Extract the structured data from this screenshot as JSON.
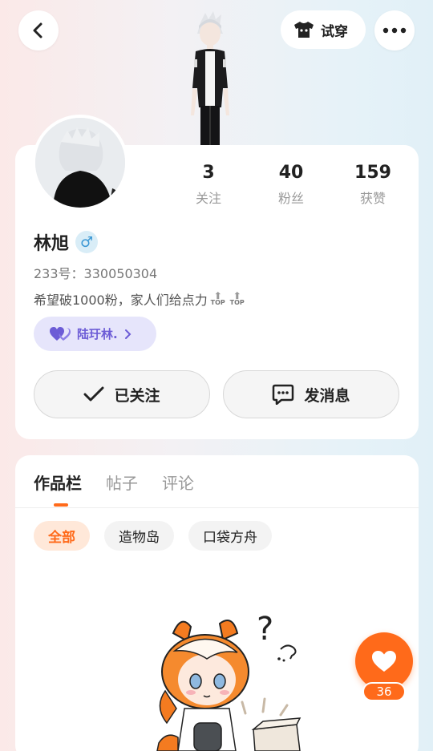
{
  "header": {
    "try_on_label": "试穿",
    "icons": {
      "back": "chevron-left-icon",
      "try_on": "tshirt-icon",
      "more": "more-dots-icon"
    }
  },
  "profile": {
    "stats": [
      {
        "value": "3",
        "label": "关注"
      },
      {
        "value": "40",
        "label": "粉丝"
      },
      {
        "value": "159",
        "label": "获赞"
      }
    ],
    "name": "林旭",
    "gender_symbol": "♂",
    "uid": "233号：330050304",
    "bio": "希望破1000粉，家人们给点力",
    "bio_badges": [
      "TOP",
      "TOP"
    ],
    "partner_label": "陆玗林.",
    "follow_label": "已关注",
    "message_label": "发消息"
  },
  "works": {
    "tabs": [
      "作品栏",
      "帖子",
      "评论"
    ],
    "active_tab": "作品栏",
    "filters": [
      "全部",
      "造物岛",
      "口袋方舟"
    ],
    "active_filter": "全部"
  },
  "like": {
    "count": "36"
  },
  "colors": {
    "accent": "#ff6a1a",
    "partner": "#6c5cd6",
    "gender": "#3a97d4"
  }
}
